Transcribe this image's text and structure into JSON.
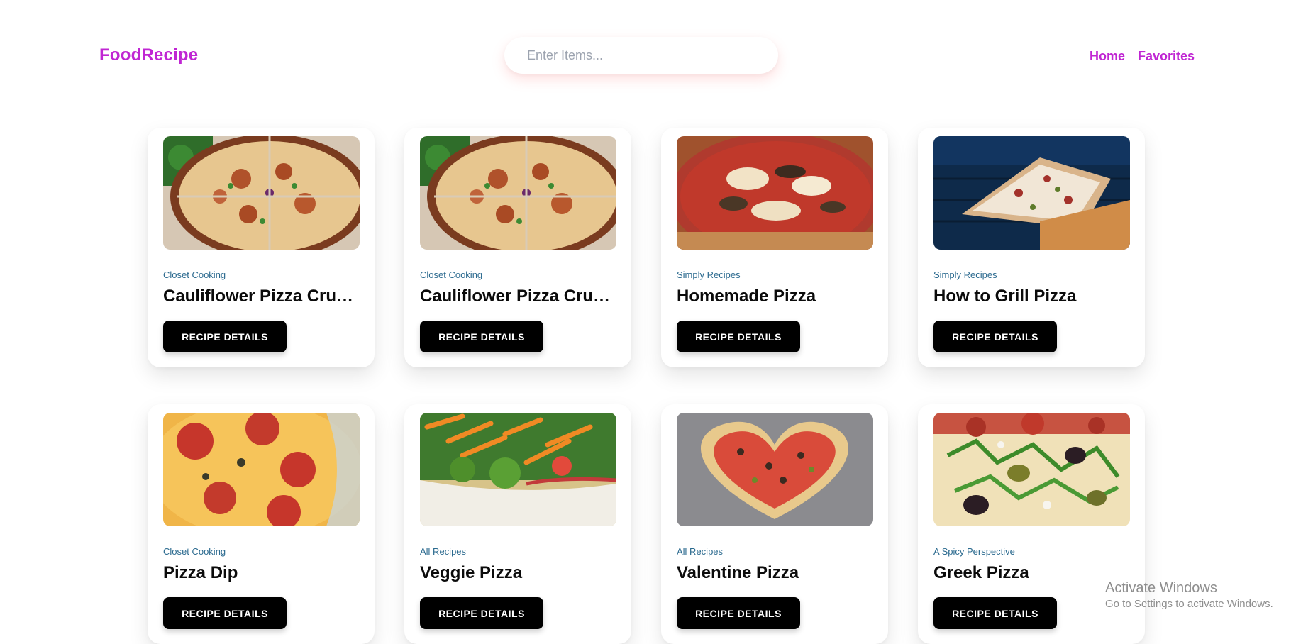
{
  "header": {
    "brand": "FoodRecipe",
    "search_placeholder": "Enter Items...",
    "nav": [
      {
        "label": "Home"
      },
      {
        "label": "Favorites"
      }
    ]
  },
  "recipes": [
    {
      "publisher": "Closet Cooking",
      "title": "Cauliflower Pizza Crust (with BBQ Chicken Pizza)",
      "button": "RECIPE DETAILS",
      "image_icon": "bbq-chicken-cauliflower-pizza"
    },
    {
      "publisher": "Closet Cooking",
      "title": "Cauliflower Pizza Crust (with BBQ Chicken Pizza)",
      "button": "RECIPE DETAILS",
      "image_icon": "bbq-chicken-cauliflower-pizza"
    },
    {
      "publisher": "Simply Recipes",
      "title": "Homemade Pizza",
      "button": "RECIPE DETAILS",
      "image_icon": "homemade-pizza"
    },
    {
      "publisher": "Simply Recipes",
      "title": "How to Grill Pizza",
      "button": "RECIPE DETAILS",
      "image_icon": "grilled-pizza"
    },
    {
      "publisher": "Closet Cooking",
      "title": "Pizza Dip",
      "button": "RECIPE DETAILS",
      "image_icon": "pepperoni-pizza-dip"
    },
    {
      "publisher": "All Recipes",
      "title": "Veggie Pizza",
      "button": "RECIPE DETAILS",
      "image_icon": "veggie-pizza"
    },
    {
      "publisher": "All Recipes",
      "title": "Valentine Pizza",
      "button": "RECIPE DETAILS",
      "image_icon": "valentine-pizza"
    },
    {
      "publisher": "A Spicy Perspective",
      "title": "Greek Pizza",
      "button": "RECIPE DETAILS",
      "image_icon": "greek-pizza"
    }
  ],
  "watermark": {
    "line1": "Activate Windows",
    "line2": "Go to Settings to activate Windows."
  },
  "colors": {
    "brand": "#c026d3",
    "publisher": "#2b6a8f",
    "button_bg": "#000000"
  }
}
